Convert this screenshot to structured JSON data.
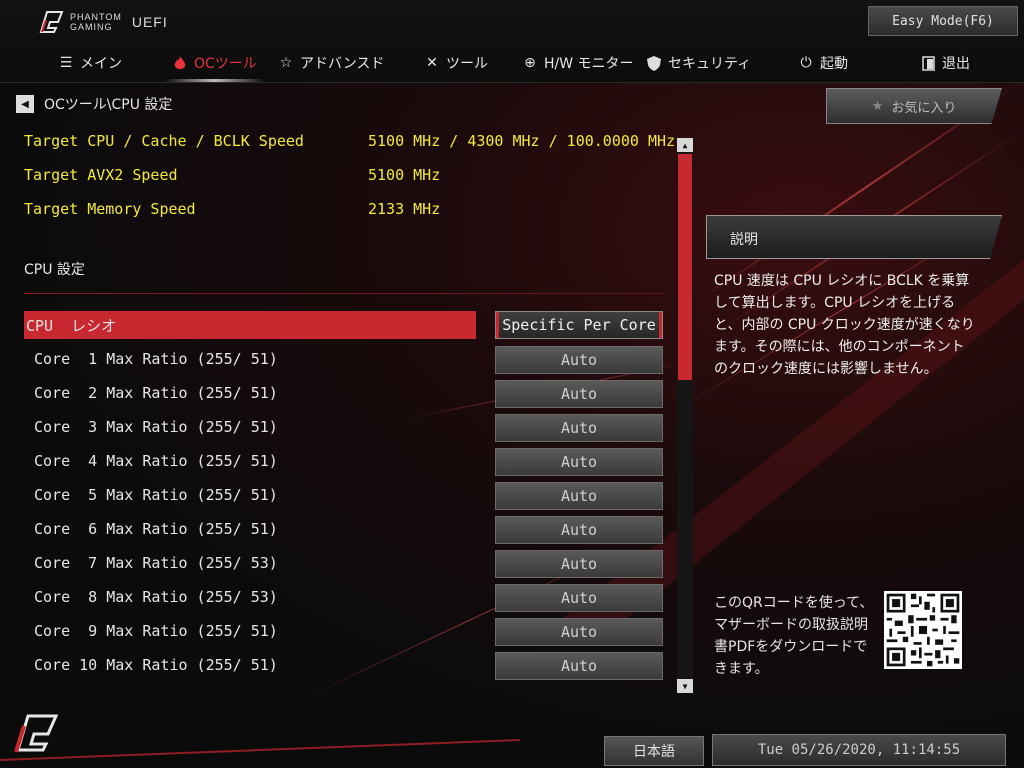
{
  "header": {
    "brand_line1": "PHANTOM",
    "brand_line2": "GAMING",
    "brand_uefi": "UEFI",
    "easy_mode_label": "Easy Mode(F6)"
  },
  "nav": {
    "tabs": [
      {
        "label": "メイン",
        "icon": "list-icon"
      },
      {
        "label": "OCツール",
        "icon": "flame-icon",
        "active": true
      },
      {
        "label": "アドバンスド",
        "icon": "star-icon"
      },
      {
        "label": "ツール",
        "icon": "tools-icon"
      },
      {
        "label": "H/W モニター",
        "icon": "crosshair-icon"
      },
      {
        "label": "セキュリティ",
        "icon": "shield-icon"
      },
      {
        "label": "起動",
        "icon": "power-icon"
      },
      {
        "label": "退出",
        "icon": "exit-door-icon"
      }
    ]
  },
  "breadcrumb": {
    "path": "OCツール\\CPU 設定"
  },
  "info": [
    {
      "label": "Target CPU / Cache / BCLK Speed",
      "value": "5100 MHz / 4300 MHz / 100.0000 MHz"
    },
    {
      "label": "Target AVX2 Speed",
      "value": "5100 MHz"
    },
    {
      "label": "Target Memory Speed",
      "value": "2133 MHz"
    }
  ],
  "section_title": "CPU 設定",
  "settings": [
    {
      "label": "CPU  レシオ",
      "value": "Specific Per Core",
      "selected": true
    },
    {
      "label": "Core  1 Max Ratio (255/ 51)",
      "value": "Auto"
    },
    {
      "label": "Core  2 Max Ratio (255/ 51)",
      "value": "Auto"
    },
    {
      "label": "Core  3 Max Ratio (255/ 51)",
      "value": "Auto"
    },
    {
      "label": "Core  4 Max Ratio (255/ 51)",
      "value": "Auto"
    },
    {
      "label": "Core  5 Max Ratio (255/ 51)",
      "value": "Auto"
    },
    {
      "label": "Core  6 Max Ratio (255/ 51)",
      "value": "Auto"
    },
    {
      "label": "Core  7 Max Ratio (255/ 53)",
      "value": "Auto"
    },
    {
      "label": "Core  8 Max Ratio (255/ 53)",
      "value": "Auto"
    },
    {
      "label": "Core  9 Max Ratio (255/ 51)",
      "value": "Auto"
    },
    {
      "label": "Core 10 Max Ratio (255/ 51)",
      "value": "Auto"
    }
  ],
  "favorites_label": "お気に入り",
  "description": {
    "title": "説明",
    "body": "CPU 速度は CPU レシオに BCLK を乗算して算出します。CPU レシオを上げると、内部の CPU クロック速度が速くなります。その際には、他のコンポーネントのクロック速度には影響しません。"
  },
  "qr_text": "このQRコードを使って、マザーボードの取扱説明書PDFをダウンロードできます。",
  "footer": {
    "language": "日本語",
    "datetime": "Tue 05/26/2020, 11:14:55"
  },
  "colors": {
    "accent_red": "#c8282f",
    "info_yellow": "#f2ea3a"
  }
}
